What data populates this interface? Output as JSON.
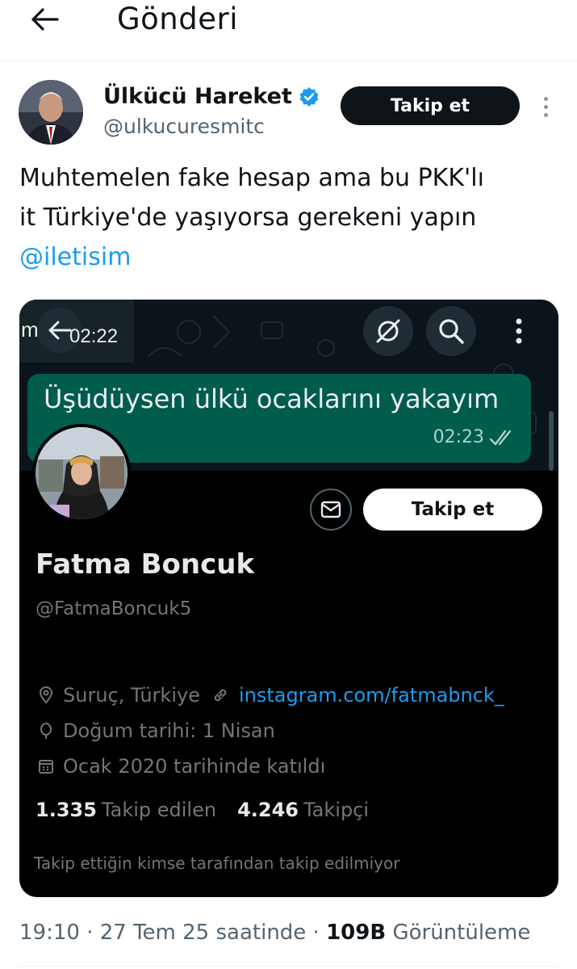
{
  "header": {
    "title": "Gönderi"
  },
  "author": {
    "name": "Ülkücü Hareket",
    "handle": "@ulkucuresmitc",
    "follow_label": "Takip et"
  },
  "tweet": {
    "text_line1": "Muhtemelen fake hesap ama bu PKK'lı",
    "text_line2": "it Türkiye'de yaşıyorsa gerekeni yapın",
    "mention": "@iletisim"
  },
  "media": {
    "whatsapp": {
      "partial_text": "m",
      "top_time": "02:22",
      "message": "Üşüdüysen ülkü ocaklarını yakayım",
      "message_time": "02:23"
    },
    "profile": {
      "follow_label": "Takip et",
      "name": "Fatma Boncuk",
      "handle": "@FatmaBoncuk5",
      "location": "Suruç, Türkiye",
      "link": "instagram.com/fatmabnck_",
      "birthday": "Doğum tarihi: 1 Nisan",
      "joined": "Ocak 2020 tarihinde katıldı",
      "following_count": "1.335",
      "following_label": "Takip edilen",
      "followers_count": "4.246",
      "followers_label": "Takipçi",
      "follow_note": "Takip ettiğin kimse tarafından takip edilmiyor"
    }
  },
  "footer": {
    "time": "19:10",
    "sep1": " · ",
    "date": "27 Tem 25 saatinde",
    "sep2": " · ",
    "views_count": "109B",
    "views_label": " Görüntüleme"
  },
  "colors": {
    "accent": "#1d9bf0",
    "whatsapp_bubble": "#005c4b",
    "dark_bg": "#000000"
  },
  "icons": [
    "back-arrow-icon",
    "verified-badge-icon",
    "more-vertical-icon",
    "no-signal-icon",
    "search-icon",
    "mail-icon",
    "location-icon",
    "link-icon",
    "balloon-icon",
    "calendar-icon",
    "double-check-icon"
  ]
}
